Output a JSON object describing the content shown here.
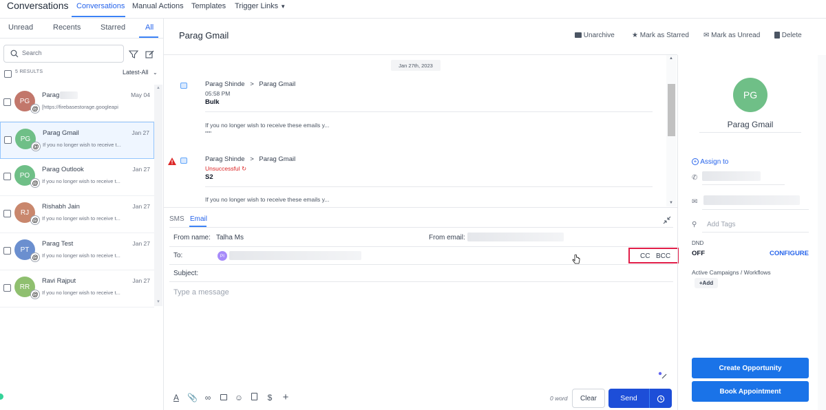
{
  "nav": {
    "title": "Conversations",
    "tabs": [
      "Conversations",
      "Manual Actions",
      "Templates",
      "Trigger Links"
    ]
  },
  "filters": {
    "tabs": [
      "Unread",
      "Recents",
      "Starred",
      "All"
    ],
    "search_placeholder": "Search",
    "results": "5 RESULTS",
    "sort": "Latest-All"
  },
  "conversations": [
    {
      "initials": "PG",
      "name": "Parag",
      "date": "May 04",
      "preview": "[https://firebasestorage.googleapi",
      "color": "#c2776b"
    },
    {
      "initials": "PG",
      "name": "Parag Gmail",
      "date": "Jan 27",
      "preview": "If you no longer wish to receive t...",
      "color": "#6fbf87"
    },
    {
      "initials": "PO",
      "name": "Parag Outlook",
      "date": "Jan 27",
      "preview": "If you no longer wish to receive t...",
      "color": "#6fbf87"
    },
    {
      "initials": "RJ",
      "name": "Rishabh Jain",
      "date": "Jan 27",
      "preview": "If you no longer wish to receive t...",
      "color": "#c9876d"
    },
    {
      "initials": "PT",
      "name": "Parag Test",
      "date": "Jan 27",
      "preview": "If you no longer wish to receive t...",
      "color": "#6b8fcf"
    },
    {
      "initials": "RR",
      "name": "Ravi Rajput",
      "date": "Jan 27",
      "preview": "If you no longer wish to receive t...",
      "color": "#8fbf6f"
    }
  ],
  "thread": {
    "title": "Parag Gmail",
    "actions": [
      "Unarchive",
      "Mark as Starred",
      "Mark as Unread",
      "Delete"
    ],
    "date_chip": "Jan 27th, 2023",
    "messages": [
      {
        "from": "Parag Shinde",
        "arrow": ">",
        "to": "Parag Gmail",
        "meta": "05:58 PM",
        "subject": "Bulk",
        "body": "If you no longer wish to receive these emails y...",
        "extra": "\"\"\""
      },
      {
        "from": "Parag Shinde",
        "arrow": ">",
        "to": "Parag Gmail",
        "meta": "Unsuccessful",
        "subject": "S2",
        "body": "If you no longer wish to receive these emails y..."
      }
    ]
  },
  "composer": {
    "tabs": [
      "SMS",
      "Email"
    ],
    "from_name_label": "From name:",
    "from_name": "Talha Ms",
    "from_email_label": "From email:",
    "to_label": "To:",
    "to_chip": "PI",
    "cc": "CC",
    "bcc": "BCC",
    "subject_label": "Subject:",
    "message_placeholder": "Type a message",
    "wordcount": "0 word",
    "clear": "Clear",
    "send": "Send"
  },
  "contact": {
    "initials": "PG",
    "name": "Parag Gmail",
    "assign": "Assign to",
    "tags_placeholder": "Add Tags",
    "dnd_label": "DND",
    "dnd_value": "OFF",
    "configure": "CONFIGURE",
    "campaigns_label": "Active Campaigns / Workflows",
    "add": "Add",
    "create_opportunity": "Create Opportunity",
    "book_appointment": "Book Appointment"
  }
}
